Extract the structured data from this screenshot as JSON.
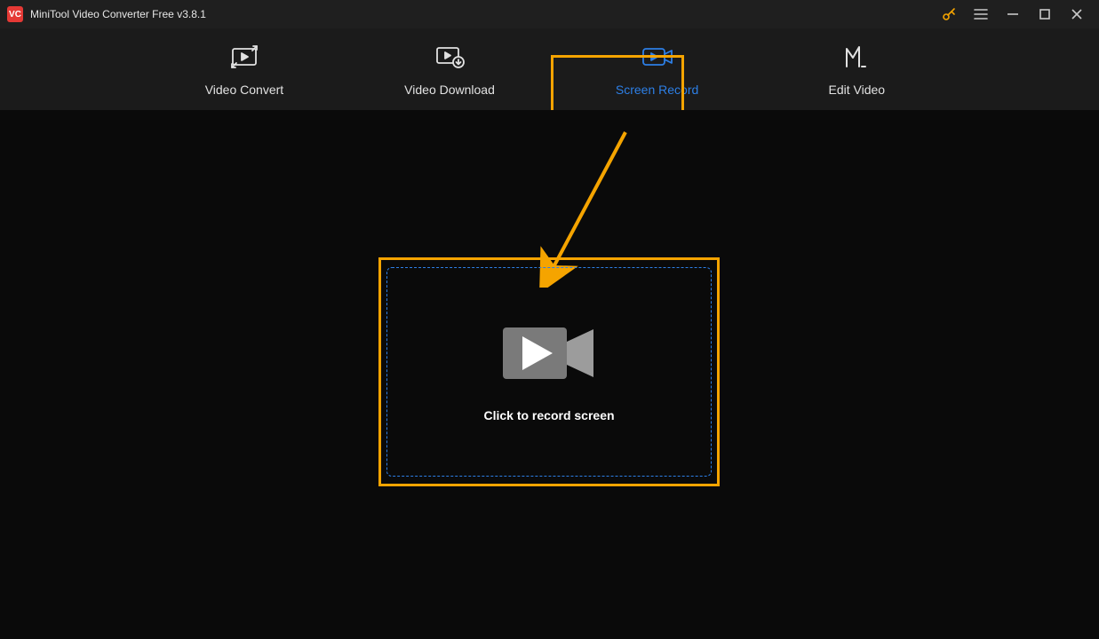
{
  "titlebar": {
    "logo_text": "VC",
    "title": "MiniTool Video Converter Free v3.8.1"
  },
  "nav": {
    "items": [
      {
        "label": "Video Convert",
        "icon": "convert-icon"
      },
      {
        "label": "Video Download",
        "icon": "download-icon"
      },
      {
        "label": "Screen Record",
        "icon": "record-icon"
      },
      {
        "label": "Edit Video",
        "icon": "edit-icon"
      }
    ],
    "active_index": 2
  },
  "main": {
    "record_label": "Click to record screen"
  },
  "colors": {
    "accent": "#2d7fe6",
    "highlight": "#f5a400"
  }
}
